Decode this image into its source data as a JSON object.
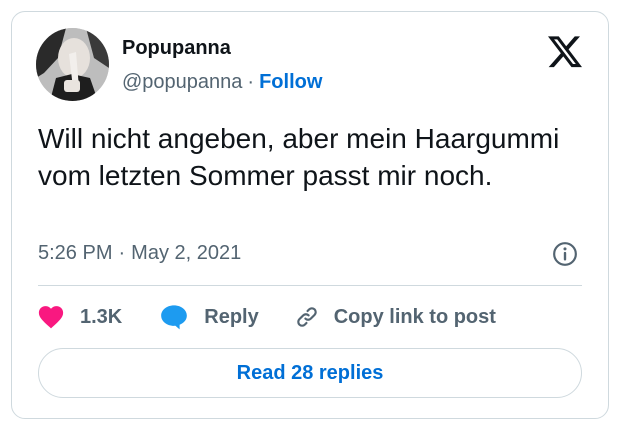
{
  "author": {
    "display_name": "Popupanna",
    "handle": "@popupanna",
    "separator": "·",
    "follow_label": "Follow"
  },
  "tweet": {
    "text": "Will nicht angeben, aber mein Haargummi vom letzten Sommer passt mir noch.",
    "time": "5:26 PM",
    "separator": "·",
    "date": "May 2, 2021"
  },
  "actions": {
    "like_count": "1.3K",
    "reply_label": "Reply",
    "copy_label": "Copy link to post"
  },
  "footer": {
    "read_replies_label": "Read 28 replies"
  },
  "icons": {
    "platform": "x-logo-icon",
    "info": "info-icon",
    "like": "heart-icon",
    "reply": "speech-bubble-icon",
    "copy": "link-icon"
  },
  "colors": {
    "like": "#f91880",
    "reply": "#1d9bf0",
    "link": "#006fd6",
    "text_primary": "#0f1419",
    "text_secondary": "#536471",
    "border": "#cfd9de"
  }
}
